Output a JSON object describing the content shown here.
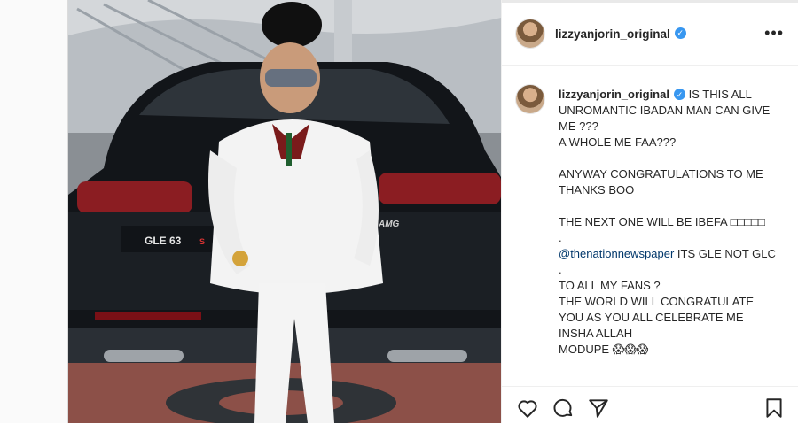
{
  "post": {
    "username": "lizzyanjorin_original",
    "verified": true,
    "caption": {
      "line1": "IS THIS ALL UNROMANTIC IBADAN MAN CAN GIVE ME ???",
      "line2": "A WHOLE ME FAA???",
      "line3": "ANYWAY CONGRATULATIONS TO ME",
      "line4": "THANKS BOO",
      "line5": "THE NEXT ONE WILL BE IBEFA □□□□□",
      "dot1": ".",
      "mention": "@thenationnewspaper",
      "mention_tail": " ITS GLE NOT GLC",
      "dot2": ".",
      "line6": "TO ALL MY FANS ?",
      "line7": "THE WORLD WILL CONGRATULATE YOU AS YOU ALL CELEBRATE ME",
      "line8": "INSHA ALLAH",
      "line9": "MODUPE 😱😱😱"
    }
  },
  "icons": {
    "more": "more-options-icon",
    "like": "heart-icon",
    "comment": "comment-bubble-icon",
    "share": "paper-plane-icon",
    "save": "bookmark-icon"
  },
  "photo": {
    "car_badge": "GLE 63",
    "car_badge_suffix": "S",
    "car_brand_badge": "AMG"
  },
  "colors": {
    "verified": "#3897f0",
    "mention": "#00376b",
    "text": "#262626",
    "divider": "#efefef"
  }
}
